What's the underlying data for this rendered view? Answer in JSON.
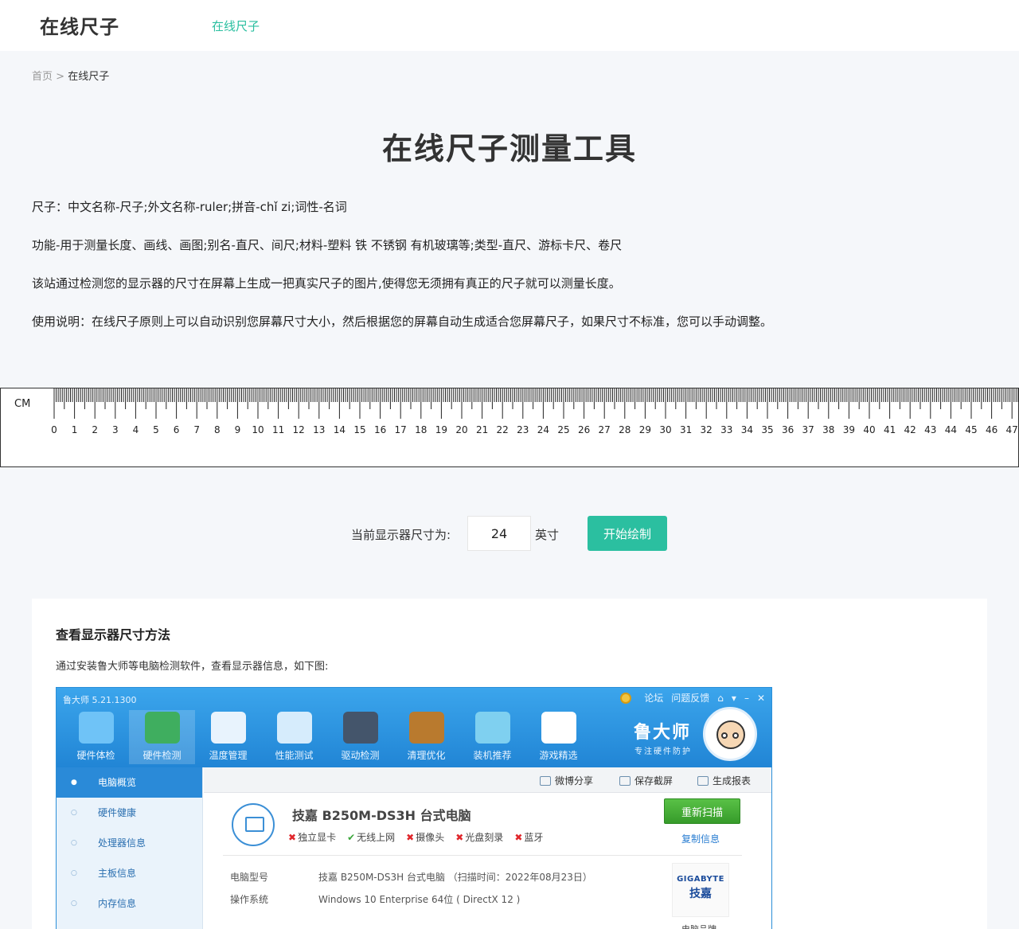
{
  "header": {
    "logo": "在线尺子",
    "nav_link": "在线尺子"
  },
  "breadcrumb": {
    "home": "首页",
    "separator": ">",
    "current": "在线尺子"
  },
  "page_title": "在线尺子测量工具",
  "paragraphs": [
    "尺子：中文名称-尺子;外文名称-ruler;拼音-chǐ zi;词性-名词",
    "功能-用于测量长度、画线、画图;别名-直尺、间尺;材料-塑料 铁 不锈钢 有机玻璃等;类型-直尺、游标卡尺、卷尺",
    "该站通过检测您的显示器的尺寸在屏幕上生成一把真实尺子的图片,使得您无须拥有真正的尺子就可以测量长度。",
    "使用说明：在线尺子原则上可以自动识别您屏幕尺寸大小，然后根据您的屏幕自动生成适合您屏幕尺子，如果尺寸不标准，您可以手动调整。"
  ],
  "ruler": {
    "unit": "CM",
    "labels": [
      "0",
      "1",
      "2",
      "3",
      "4",
      "5",
      "6",
      "7",
      "8",
      "9",
      "10",
      "11",
      "12",
      "13",
      "14",
      "15",
      "16",
      "17",
      "18",
      "19",
      "20",
      "21",
      "22",
      "23",
      "24",
      "25",
      "26",
      "27",
      "28",
      "29",
      "30",
      "31",
      "32",
      "33",
      "34",
      "35",
      "36",
      "37",
      "38",
      "39",
      "40",
      "41",
      "42",
      "43",
      "44",
      "45",
      "46",
      "47"
    ]
  },
  "monitor_size": {
    "label": "当前显示器尺寸为:",
    "value": "24",
    "unit": "英寸",
    "button": "开始绘制"
  },
  "guide": {
    "title": "查看显示器尺寸方法",
    "desc": "通过安装鲁大师等电脑检测软件，查看显示器信息，如下图:",
    "screenshot": {
      "version": "鲁大师 5.21.1300",
      "top_links": [
        "论坛",
        "问题反馈"
      ],
      "tools": [
        {
          "label": "硬件体检",
          "color": "#6fc3f7"
        },
        {
          "label": "硬件检测",
          "color": "#3fae5f"
        },
        {
          "label": "温度管理",
          "color": "#e8f3fd"
        },
        {
          "label": "性能测试",
          "color": "#d6ecfc"
        },
        {
          "label": "驱动检测",
          "color": "#44556b"
        },
        {
          "label": "清理优化",
          "color": "#b97a2e"
        },
        {
          "label": "装机推荐",
          "color": "#7fd0f0"
        },
        {
          "label": "游戏精选",
          "color": "#ffffff"
        }
      ],
      "brand": {
        "name": "鲁大师",
        "tagline": "专注硬件防护"
      },
      "sidebar": [
        "电脑概览",
        "硬件健康",
        "处理器信息",
        "主板信息",
        "内存信息"
      ],
      "toolbar": [
        "微博分享",
        "保存截屏",
        "生成报表"
      ],
      "pc_title": "技嘉 B250M-DS3H 台式电脑",
      "hw_tags": [
        {
          "label": "独立显卡",
          "ok": false
        },
        {
          "label": "无线上网",
          "ok": true
        },
        {
          "label": "摄像头",
          "ok": false
        },
        {
          "label": "光盘刻录",
          "ok": false
        },
        {
          "label": "蓝牙",
          "ok": false
        }
      ],
      "rescan": "重新扫描",
      "copy_info": "复制信息",
      "info": [
        {
          "key": "电脑型号",
          "value": "技嘉 B250M-DS3H 台式电脑 （扫描时间：2022年08月23日）"
        },
        {
          "key": "操作系统",
          "value": "Windows 10 Enterprise 64位 ( DirectX 12 )"
        }
      ],
      "vendor": {
        "en": "GIGABYTE",
        "cn": "技嘉",
        "label": "电脑品牌"
      }
    }
  }
}
